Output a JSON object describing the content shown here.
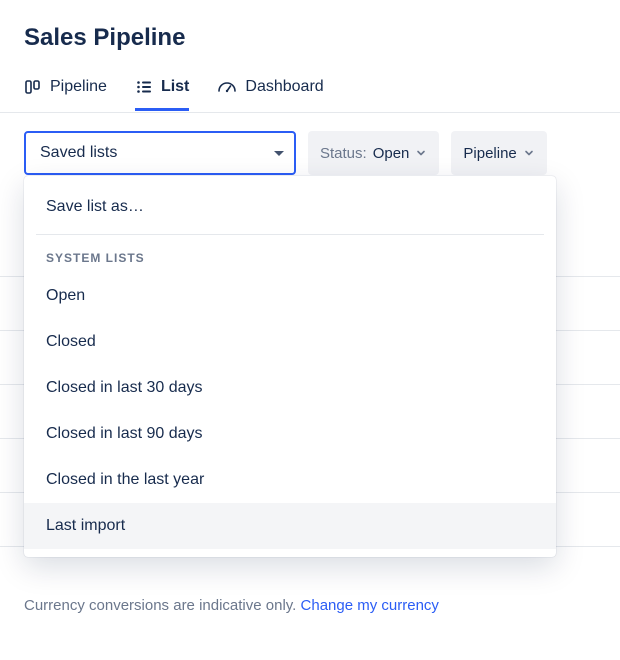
{
  "page_title": "Sales Pipeline",
  "tabs": {
    "pipeline": "Pipeline",
    "list": "List",
    "dashboard": "Dashboard"
  },
  "filters": {
    "saved_lists_label": "Saved lists",
    "status_label": "Status:",
    "status_value": "Open",
    "pipeline_label": "Pipeline"
  },
  "dropdown": {
    "save_as": "Save list as…",
    "section_header": "SYSTEM LISTS",
    "items": {
      "open": "Open",
      "closed": "Closed",
      "closed_30": "Closed in last 30 days",
      "closed_90": "Closed in last 90 days",
      "closed_year": "Closed in the last year",
      "last_import": "Last import"
    }
  },
  "footer": {
    "note": "Currency conversions are indicative only. ",
    "link": "Change my currency"
  }
}
